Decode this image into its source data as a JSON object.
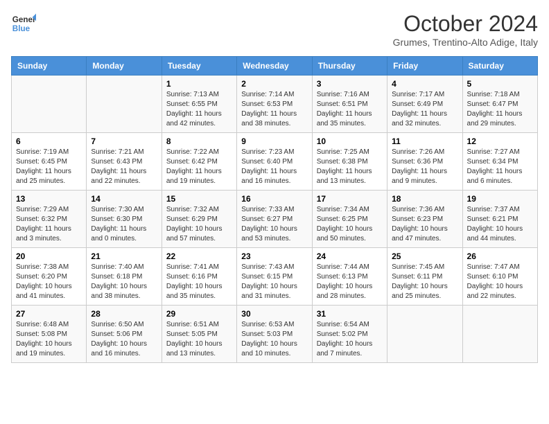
{
  "header": {
    "logo_line1": "General",
    "logo_line2": "Blue",
    "month_title": "October 2024",
    "subtitle": "Grumes, Trentino-Alto Adige, Italy"
  },
  "days_of_week": [
    "Sunday",
    "Monday",
    "Tuesday",
    "Wednesday",
    "Thursday",
    "Friday",
    "Saturday"
  ],
  "weeks": [
    [
      {
        "day": "",
        "info": ""
      },
      {
        "day": "",
        "info": ""
      },
      {
        "day": "1",
        "info": "Sunrise: 7:13 AM\nSunset: 6:55 PM\nDaylight: 11 hours and 42 minutes."
      },
      {
        "day": "2",
        "info": "Sunrise: 7:14 AM\nSunset: 6:53 PM\nDaylight: 11 hours and 38 minutes."
      },
      {
        "day": "3",
        "info": "Sunrise: 7:16 AM\nSunset: 6:51 PM\nDaylight: 11 hours and 35 minutes."
      },
      {
        "day": "4",
        "info": "Sunrise: 7:17 AM\nSunset: 6:49 PM\nDaylight: 11 hours and 32 minutes."
      },
      {
        "day": "5",
        "info": "Sunrise: 7:18 AM\nSunset: 6:47 PM\nDaylight: 11 hours and 29 minutes."
      }
    ],
    [
      {
        "day": "6",
        "info": "Sunrise: 7:19 AM\nSunset: 6:45 PM\nDaylight: 11 hours and 25 minutes."
      },
      {
        "day": "7",
        "info": "Sunrise: 7:21 AM\nSunset: 6:43 PM\nDaylight: 11 hours and 22 minutes."
      },
      {
        "day": "8",
        "info": "Sunrise: 7:22 AM\nSunset: 6:42 PM\nDaylight: 11 hours and 19 minutes."
      },
      {
        "day": "9",
        "info": "Sunrise: 7:23 AM\nSunset: 6:40 PM\nDaylight: 11 hours and 16 minutes."
      },
      {
        "day": "10",
        "info": "Sunrise: 7:25 AM\nSunset: 6:38 PM\nDaylight: 11 hours and 13 minutes."
      },
      {
        "day": "11",
        "info": "Sunrise: 7:26 AM\nSunset: 6:36 PM\nDaylight: 11 hours and 9 minutes."
      },
      {
        "day": "12",
        "info": "Sunrise: 7:27 AM\nSunset: 6:34 PM\nDaylight: 11 hours and 6 minutes."
      }
    ],
    [
      {
        "day": "13",
        "info": "Sunrise: 7:29 AM\nSunset: 6:32 PM\nDaylight: 11 hours and 3 minutes."
      },
      {
        "day": "14",
        "info": "Sunrise: 7:30 AM\nSunset: 6:30 PM\nDaylight: 11 hours and 0 minutes."
      },
      {
        "day": "15",
        "info": "Sunrise: 7:32 AM\nSunset: 6:29 PM\nDaylight: 10 hours and 57 minutes."
      },
      {
        "day": "16",
        "info": "Sunrise: 7:33 AM\nSunset: 6:27 PM\nDaylight: 10 hours and 53 minutes."
      },
      {
        "day": "17",
        "info": "Sunrise: 7:34 AM\nSunset: 6:25 PM\nDaylight: 10 hours and 50 minutes."
      },
      {
        "day": "18",
        "info": "Sunrise: 7:36 AM\nSunset: 6:23 PM\nDaylight: 10 hours and 47 minutes."
      },
      {
        "day": "19",
        "info": "Sunrise: 7:37 AM\nSunset: 6:21 PM\nDaylight: 10 hours and 44 minutes."
      }
    ],
    [
      {
        "day": "20",
        "info": "Sunrise: 7:38 AM\nSunset: 6:20 PM\nDaylight: 10 hours and 41 minutes."
      },
      {
        "day": "21",
        "info": "Sunrise: 7:40 AM\nSunset: 6:18 PM\nDaylight: 10 hours and 38 minutes."
      },
      {
        "day": "22",
        "info": "Sunrise: 7:41 AM\nSunset: 6:16 PM\nDaylight: 10 hours and 35 minutes."
      },
      {
        "day": "23",
        "info": "Sunrise: 7:43 AM\nSunset: 6:15 PM\nDaylight: 10 hours and 31 minutes."
      },
      {
        "day": "24",
        "info": "Sunrise: 7:44 AM\nSunset: 6:13 PM\nDaylight: 10 hours and 28 minutes."
      },
      {
        "day": "25",
        "info": "Sunrise: 7:45 AM\nSunset: 6:11 PM\nDaylight: 10 hours and 25 minutes."
      },
      {
        "day": "26",
        "info": "Sunrise: 7:47 AM\nSunset: 6:10 PM\nDaylight: 10 hours and 22 minutes."
      }
    ],
    [
      {
        "day": "27",
        "info": "Sunrise: 6:48 AM\nSunset: 5:08 PM\nDaylight: 10 hours and 19 minutes."
      },
      {
        "day": "28",
        "info": "Sunrise: 6:50 AM\nSunset: 5:06 PM\nDaylight: 10 hours and 16 minutes."
      },
      {
        "day": "29",
        "info": "Sunrise: 6:51 AM\nSunset: 5:05 PM\nDaylight: 10 hours and 13 minutes."
      },
      {
        "day": "30",
        "info": "Sunrise: 6:53 AM\nSunset: 5:03 PM\nDaylight: 10 hours and 10 minutes."
      },
      {
        "day": "31",
        "info": "Sunrise: 6:54 AM\nSunset: 5:02 PM\nDaylight: 10 hours and 7 minutes."
      },
      {
        "day": "",
        "info": ""
      },
      {
        "day": "",
        "info": ""
      }
    ]
  ]
}
